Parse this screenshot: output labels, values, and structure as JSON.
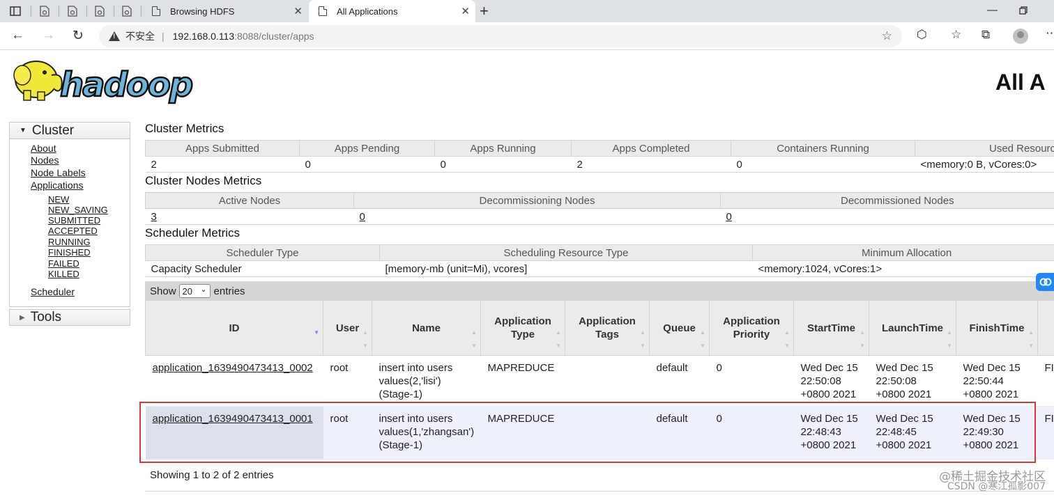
{
  "browser": {
    "tabs": [
      {
        "title": "Browsing HDFS",
        "active": false
      },
      {
        "title": "All Applications",
        "active": true
      }
    ],
    "address": {
      "security_label": "不安全",
      "host": "192.168.0.113",
      "path": ":8088/cluster/apps"
    }
  },
  "page": {
    "title": "All A"
  },
  "sidebar": {
    "cluster_label": "Cluster",
    "links": [
      "About",
      "Nodes",
      "Node Labels",
      "Applications"
    ],
    "app_states": [
      "NEW",
      "NEW_SAVING",
      "SUBMITTED",
      "ACCEPTED",
      "RUNNING",
      "FINISHED",
      "FAILED",
      "KILLED"
    ],
    "scheduler_label": "Scheduler",
    "tools_label": "Tools"
  },
  "cluster_metrics": {
    "title": "Cluster Metrics",
    "headers": [
      "Apps Submitted",
      "Apps Pending",
      "Apps Running",
      "Apps Completed",
      "Containers Running",
      "Used Resources"
    ],
    "values": [
      "2",
      "0",
      "0",
      "2",
      "0",
      "<memory:0 B, vCores:0>"
    ]
  },
  "cluster_nodes_metrics": {
    "title": "Cluster Nodes Metrics",
    "headers": [
      "Active Nodes",
      "Decommissioning Nodes",
      "Decommissioned Nodes"
    ],
    "values": [
      "3",
      "0",
      "0"
    ]
  },
  "scheduler_metrics": {
    "title": "Scheduler Metrics",
    "headers": [
      "Scheduler Type",
      "Scheduling Resource Type",
      "Minimum Allocation"
    ],
    "values": [
      "Capacity Scheduler",
      "[memory-mb (unit=Mi), vcores]",
      "<memory:1024, vCores:1>"
    ]
  },
  "apps_table": {
    "show_label": "Show",
    "entries_value": "20",
    "entries_label": "entries",
    "headers": {
      "id": "ID",
      "user": "User",
      "name": "Name",
      "type": [
        "Application",
        "Type"
      ],
      "tags": [
        "Application",
        "Tags"
      ],
      "queue": "Queue",
      "priority": [
        "Application",
        "Priority"
      ],
      "start": "StartTime",
      "launch": "LaunchTime",
      "finish": "FinishTime"
    },
    "rows": [
      {
        "id": "application_1639490473413_0002",
        "user": "root",
        "name": [
          "insert into users",
          "values(2,'lisi')",
          "(Stage-1)"
        ],
        "type": "MAPREDUCE",
        "tags": "",
        "queue": "default",
        "priority": "0",
        "start": [
          "Wed Dec 15",
          "22:50:08",
          "+0800 2021"
        ],
        "launch": [
          "Wed Dec 15",
          "22:50:08",
          "+0800 2021"
        ],
        "finish": [
          "Wed Dec 15",
          "22:50:44",
          "+0800 2021"
        ],
        "state": "FI"
      },
      {
        "id": "application_1639490473413_0001",
        "user": "root",
        "name": [
          "insert into users",
          "values(1,'zhangsan')",
          "(Stage-1)"
        ],
        "type": "MAPREDUCE",
        "tags": "",
        "queue": "default",
        "priority": "0",
        "start": [
          "Wed Dec 15",
          "22:48:43",
          "+0800 2021"
        ],
        "launch": [
          "Wed Dec 15",
          "22:48:45",
          "+0800 2021"
        ],
        "finish": [
          "Wed Dec 15",
          "22:49:30",
          "+0800 2021"
        ],
        "state": "FI"
      }
    ],
    "footer": "Showing 1 to 2 of 2 entries"
  },
  "watermark": {
    "line1": "@稀土掘金技术社区",
    "line2": "CSDN @寒江孤影007"
  }
}
